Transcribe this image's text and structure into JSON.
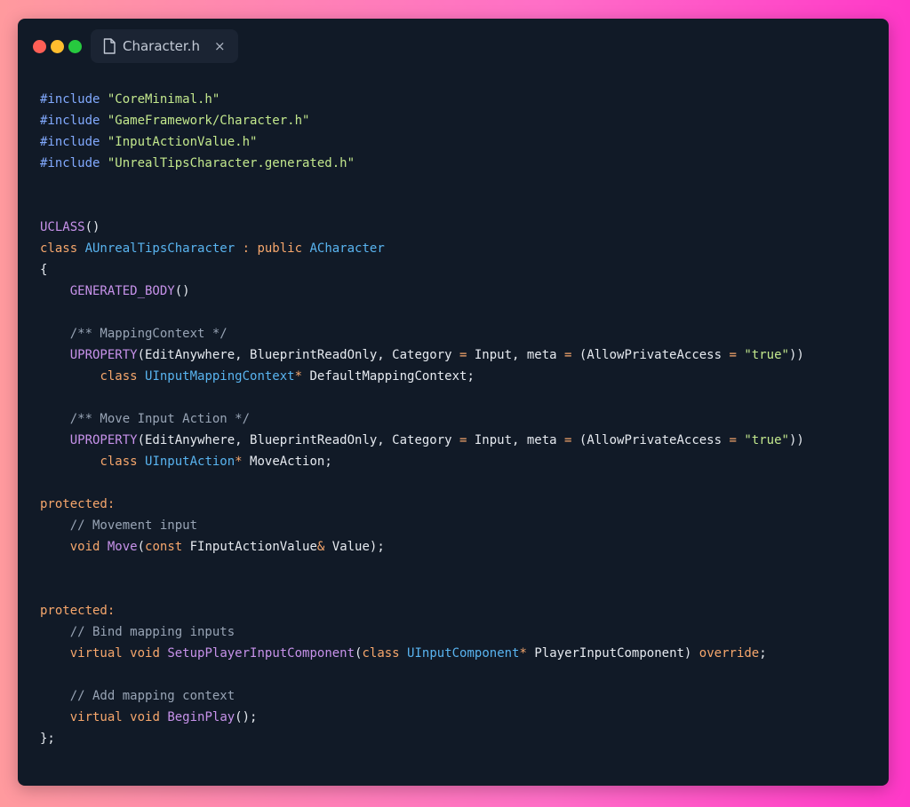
{
  "window": {
    "colors": {
      "red": "#ff5f56",
      "yellow": "#ffbd2e",
      "green": "#27c93f"
    },
    "tab": {
      "title": "Character.h",
      "close_glyph": "×"
    }
  },
  "code": {
    "lines": [
      [
        {
          "t": "#include ",
          "c": "pre"
        },
        {
          "t": "\"CoreMinimal.h\"",
          "c": "str"
        }
      ],
      [
        {
          "t": "#include ",
          "c": "pre"
        },
        {
          "t": "\"GameFramework/Character.h\"",
          "c": "str"
        }
      ],
      [
        {
          "t": "#include ",
          "c": "pre"
        },
        {
          "t": "\"InputActionValue.h\"",
          "c": "str"
        }
      ],
      [
        {
          "t": "#include ",
          "c": "pre"
        },
        {
          "t": "\"UnrealTipsCharacter.generated.h\"",
          "c": "str"
        }
      ],
      [],
      [],
      [
        {
          "t": "UCLASS",
          "c": "macro"
        },
        {
          "t": "()",
          "c": ""
        }
      ],
      [
        {
          "t": "class ",
          "c": "kw"
        },
        {
          "t": "AUnrealTipsCharacter",
          "c": "type"
        },
        {
          "t": " : ",
          "c": "op"
        },
        {
          "t": "public ",
          "c": "kw"
        },
        {
          "t": "ACharacter",
          "c": "type"
        }
      ],
      [
        {
          "t": "{",
          "c": ""
        }
      ],
      [
        {
          "t": "    ",
          "c": ""
        },
        {
          "t": "GENERATED_BODY",
          "c": "macro"
        },
        {
          "t": "()",
          "c": ""
        }
      ],
      [],
      [
        {
          "t": "    ",
          "c": ""
        },
        {
          "t": "/** MappingContext */",
          "c": "com"
        }
      ],
      [
        {
          "t": "    ",
          "c": ""
        },
        {
          "t": "UPROPERTY",
          "c": "macro"
        },
        {
          "t": "(EditAnywhere, BlueprintReadOnly, Category ",
          "c": ""
        },
        {
          "t": "=",
          "c": "op"
        },
        {
          "t": " Input, meta ",
          "c": ""
        },
        {
          "t": "=",
          "c": "op"
        },
        {
          "t": " (AllowPrivateAccess ",
          "c": ""
        },
        {
          "t": "=",
          "c": "op"
        },
        {
          "t": " ",
          "c": ""
        },
        {
          "t": "\"true\"",
          "c": "str"
        },
        {
          "t": "))",
          "c": ""
        }
      ],
      [
        {
          "t": "        ",
          "c": ""
        },
        {
          "t": "class ",
          "c": "kw"
        },
        {
          "t": "UInputMappingContext",
          "c": "type"
        },
        {
          "t": "*",
          "c": "op"
        },
        {
          "t": " DefaultMappingContext;",
          "c": ""
        }
      ],
      [],
      [
        {
          "t": "    ",
          "c": ""
        },
        {
          "t": "/** Move Input Action */",
          "c": "com"
        }
      ],
      [
        {
          "t": "    ",
          "c": ""
        },
        {
          "t": "UPROPERTY",
          "c": "macro"
        },
        {
          "t": "(EditAnywhere, BlueprintReadOnly, Category ",
          "c": ""
        },
        {
          "t": "=",
          "c": "op"
        },
        {
          "t": " Input, meta ",
          "c": ""
        },
        {
          "t": "=",
          "c": "op"
        },
        {
          "t": " (AllowPrivateAccess ",
          "c": ""
        },
        {
          "t": "=",
          "c": "op"
        },
        {
          "t": " ",
          "c": ""
        },
        {
          "t": "\"true\"",
          "c": "str"
        },
        {
          "t": "))",
          "c": ""
        }
      ],
      [
        {
          "t": "        ",
          "c": ""
        },
        {
          "t": "class ",
          "c": "kw"
        },
        {
          "t": "UInputAction",
          "c": "type"
        },
        {
          "t": "*",
          "c": "op"
        },
        {
          "t": " MoveAction;",
          "c": ""
        }
      ],
      [],
      [
        {
          "t": "protected:",
          "c": "kw"
        }
      ],
      [
        {
          "t": "    ",
          "c": ""
        },
        {
          "t": "// Movement input",
          "c": "com"
        }
      ],
      [
        {
          "t": "    ",
          "c": ""
        },
        {
          "t": "void ",
          "c": "kw"
        },
        {
          "t": "Move",
          "c": "fn"
        },
        {
          "t": "(",
          "c": ""
        },
        {
          "t": "const ",
          "c": "kw"
        },
        {
          "t": "FInputActionValue",
          "c": ""
        },
        {
          "t": "&",
          "c": "op"
        },
        {
          "t": " Value);",
          "c": ""
        }
      ],
      [],
      [],
      [
        {
          "t": "protected:",
          "c": "kw"
        }
      ],
      [
        {
          "t": "    ",
          "c": ""
        },
        {
          "t": "// Bind mapping inputs",
          "c": "com"
        }
      ],
      [
        {
          "t": "    ",
          "c": ""
        },
        {
          "t": "virtual ",
          "c": "kw"
        },
        {
          "t": "void ",
          "c": "kw"
        },
        {
          "t": "SetupPlayerInputComponent",
          "c": "fn"
        },
        {
          "t": "(",
          "c": ""
        },
        {
          "t": "class ",
          "c": "kw"
        },
        {
          "t": "UInputComponent",
          "c": "type"
        },
        {
          "t": "*",
          "c": "op"
        },
        {
          "t": " PlayerInputComponent) ",
          "c": ""
        },
        {
          "t": "override",
          "c": "kw"
        },
        {
          "t": ";",
          "c": ""
        }
      ],
      [],
      [
        {
          "t": "    ",
          "c": ""
        },
        {
          "t": "// Add mapping context",
          "c": "com"
        }
      ],
      [
        {
          "t": "    ",
          "c": ""
        },
        {
          "t": "virtual ",
          "c": "kw"
        },
        {
          "t": "void ",
          "c": "kw"
        },
        {
          "t": "BeginPlay",
          "c": "fn"
        },
        {
          "t": "();",
          "c": ""
        }
      ],
      [
        {
          "t": "};",
          "c": ""
        }
      ]
    ]
  }
}
